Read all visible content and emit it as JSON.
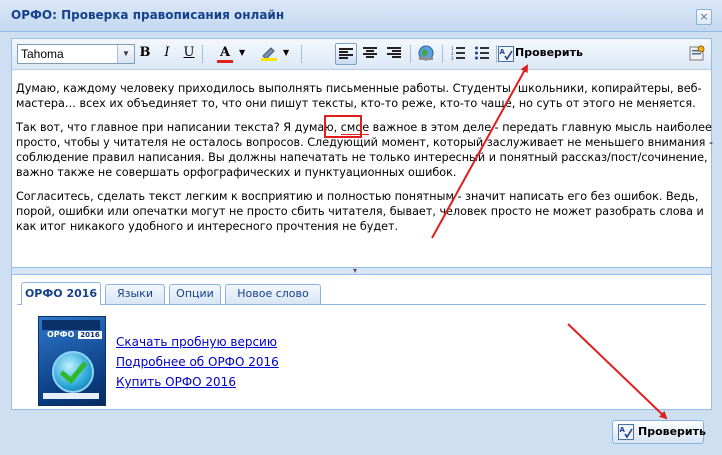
{
  "window": {
    "title": "ОРФО: Проверка правописания онлайн",
    "close_glyph": "×"
  },
  "toolbar": {
    "font_name": "Tahoma",
    "bold": "B",
    "italic": "I",
    "underline": "U",
    "font_color": "A",
    "check_label": "Проверить",
    "font_color_accent": "#e0201e",
    "highlight_accent": "#f5e400"
  },
  "editor": {
    "paragraphs": [
      [
        "Думаю, каждому человеку приходилось выполнять  письменные работы. Студенты, школьники, копирайтеры, веб-",
        "мастера… всех их объединяет то, что они пишут тексты, кто-то реже, кто-то чаще, но суть от этого не меняется."
      ],
      [
        "Так вот, что главное при написании текста? Я думаю, ",
        "смое",
        " важное в этом деле - передать главную мысль наиболее",
        "просто, чтобы у читателя не осталось вопросов. Следующий момент, который заслуживает не меньшего внимания -",
        "соблюдение правил написания. Вы должны напечатать не только интересный и понятный рассказ/пост/сочинение,",
        "важно также не совершать орфографических и пунктуационных ошибок."
      ],
      [
        "Согласитесь, сделать текст легким к восприятию и полностью понятным - значит написать его без ошибок. Ведь,",
        "порой, ошибки или опечатки могут не просто сбить читателя, бывает, человек просто не может разобрать слова и",
        "как итог никакого удобного и интересного прочтения не будет."
      ]
    ],
    "error_color": "#e01e1e"
  },
  "tabs": [
    "ОРФО 2016",
    "Языки",
    "Опции",
    "Новое слово"
  ],
  "product": {
    "brand": "ОРФО",
    "year": "2016"
  },
  "links": [
    "Скачать пробную версию",
    "Подробнее об ОРФО 2016",
    "Купить ОРФО 2016"
  ],
  "footer": {
    "check_label": "Проверить"
  },
  "colors": {
    "title_text": "#15428b",
    "annotation": "#e01e1e",
    "link": "#0000cc"
  }
}
